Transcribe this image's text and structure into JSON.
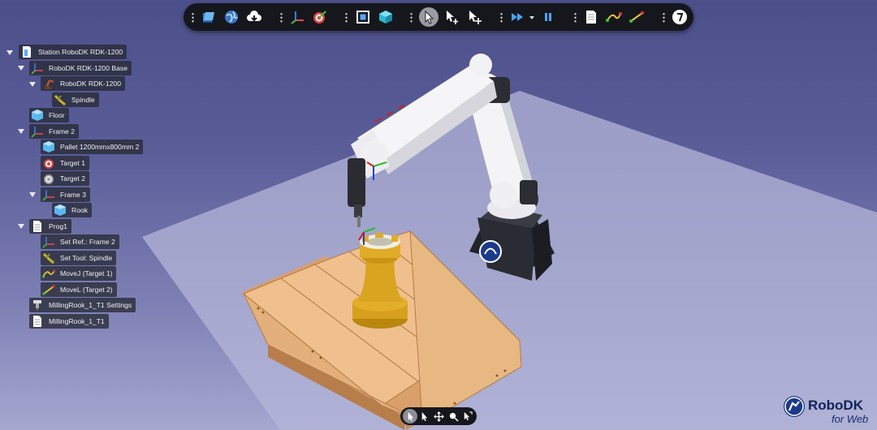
{
  "app": {
    "brand": "RoboDK",
    "brand_sub": "for Web"
  },
  "toolbar": {
    "buttons": [
      {
        "name": "open-station-icon"
      },
      {
        "name": "online-library-icon"
      },
      {
        "name": "download-icon"
      },
      {
        "name": "add-reference-frame-icon"
      },
      {
        "name": "add-target-icon"
      },
      {
        "name": "fit-all-icon"
      },
      {
        "name": "view-3d-icon"
      },
      {
        "name": "select-cursor-icon",
        "active": true
      },
      {
        "name": "move-reference-icon"
      },
      {
        "name": "move-tool-icon"
      },
      {
        "name": "run-program-icon"
      },
      {
        "name": "pause-icon"
      },
      {
        "name": "add-program-icon"
      },
      {
        "name": "add-joint-move-icon"
      },
      {
        "name": "add-linear-move-icon"
      },
      {
        "name": "help-icon"
      }
    ]
  },
  "tree": {
    "items": [
      {
        "label": "Station RoboDK RDK-1200",
        "icon": "station-icon",
        "expanded": true
      },
      {
        "label": "RoboDK RDK-1200 Base",
        "icon": "reference-frame-icon",
        "expanded": true
      },
      {
        "label": "RoboDK RDK-1200",
        "icon": "robot-icon",
        "expanded": true
      },
      {
        "label": "Spindle",
        "icon": "tool-icon"
      },
      {
        "label": "Floor",
        "icon": "object-icon"
      },
      {
        "label": "Frame 2",
        "icon": "reference-frame-icon",
        "expanded": true
      },
      {
        "label": "Pallet 1200mmx800mm 2",
        "icon": "object-icon"
      },
      {
        "label": "Target 1",
        "icon": "target-icon"
      },
      {
        "label": "Target 2",
        "icon": "target-gray-icon"
      },
      {
        "label": "Frame 3",
        "icon": "reference-frame-icon",
        "expanded": true
      },
      {
        "label": "Rook",
        "icon": "object-icon"
      },
      {
        "label": "Prog1",
        "icon": "program-icon",
        "expanded": true
      },
      {
        "label": "Set Ref.: Frame 2",
        "icon": "reference-frame-icon"
      },
      {
        "label": "Set Tool: Spindle",
        "icon": "tool-icon"
      },
      {
        "label": "MoveJ (Target 1)",
        "icon": "movej-icon"
      },
      {
        "label": "MoveL (Target 2)",
        "icon": "movel-icon"
      },
      {
        "label": "MillingRook_1_T1 Settings",
        "icon": "milling-settings-icon"
      },
      {
        "label": "MillingRook_1_T1",
        "icon": "program-icon"
      }
    ]
  },
  "bottombar": {
    "buttons": [
      {
        "name": "select-mode-icon",
        "active": true
      },
      {
        "name": "pointer-icon"
      },
      {
        "name": "pan-icon"
      },
      {
        "name": "rotate-icon"
      },
      {
        "name": "zoom-cursor-icon"
      }
    ]
  },
  "colors": {
    "background_top": "#4c4f89",
    "floor": "#b4b6d8",
    "pallet": "#e2ae7a",
    "rook": "#d9a520",
    "robot_body": "#f2f2f4",
    "robot_base": "#26282d",
    "brand_blue": "#1b3a8a"
  }
}
